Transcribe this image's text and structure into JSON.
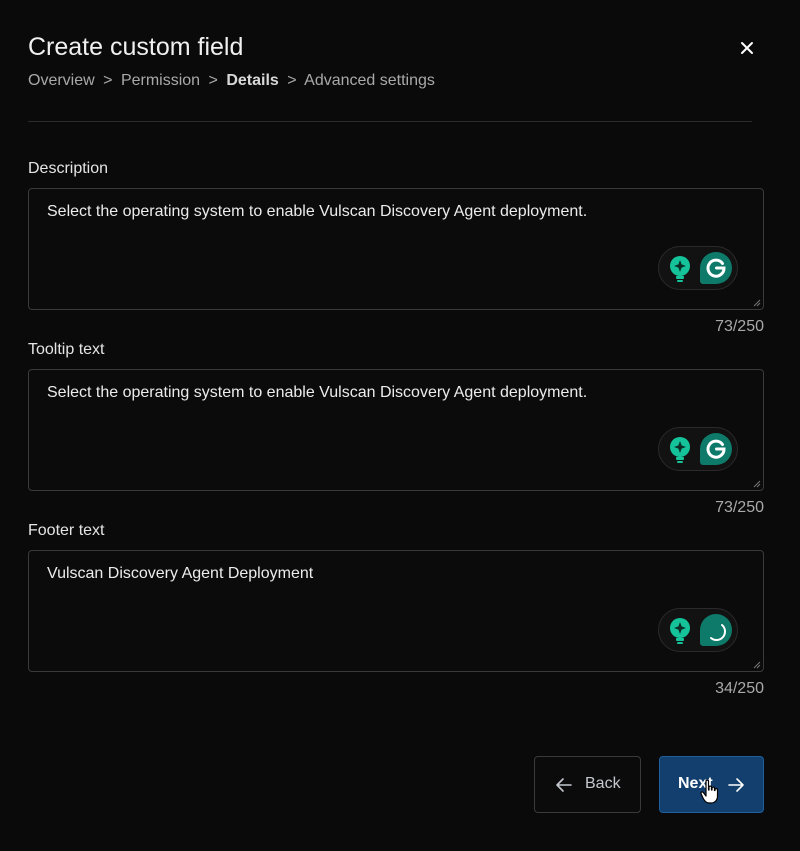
{
  "dialog": {
    "title": "Create custom field",
    "close_icon": "close-icon",
    "breadcrumb": [
      {
        "label": "Overview",
        "current": false
      },
      {
        "label": "Permission",
        "current": false
      },
      {
        "label": "Details",
        "current": true
      },
      {
        "label": "Advanced settings",
        "current": false
      }
    ],
    "breadcrumb_separator": ">"
  },
  "fields": [
    {
      "label": "Description",
      "value": "Select the operating system to enable Vulscan Discovery Agent deployment.",
      "counter": "73/250"
    },
    {
      "label": "Tooltip text",
      "value": "Select the operating system to enable Vulscan Discovery Agent deployment.",
      "counter": "73/250"
    },
    {
      "label": "Footer text",
      "value": "Vulscan Discovery Agent Deployment",
      "counter": "34/250"
    }
  ],
  "assistant_icons": [
    "lightbulb-sparkle-icon",
    "grammarly-g-icon"
  ],
  "footer": {
    "back_label": "Back",
    "next_label": "Next"
  },
  "colors": {
    "background": "#0a0a0a",
    "accent_teal": "#15c39a",
    "next_button": "#123f6e"
  }
}
